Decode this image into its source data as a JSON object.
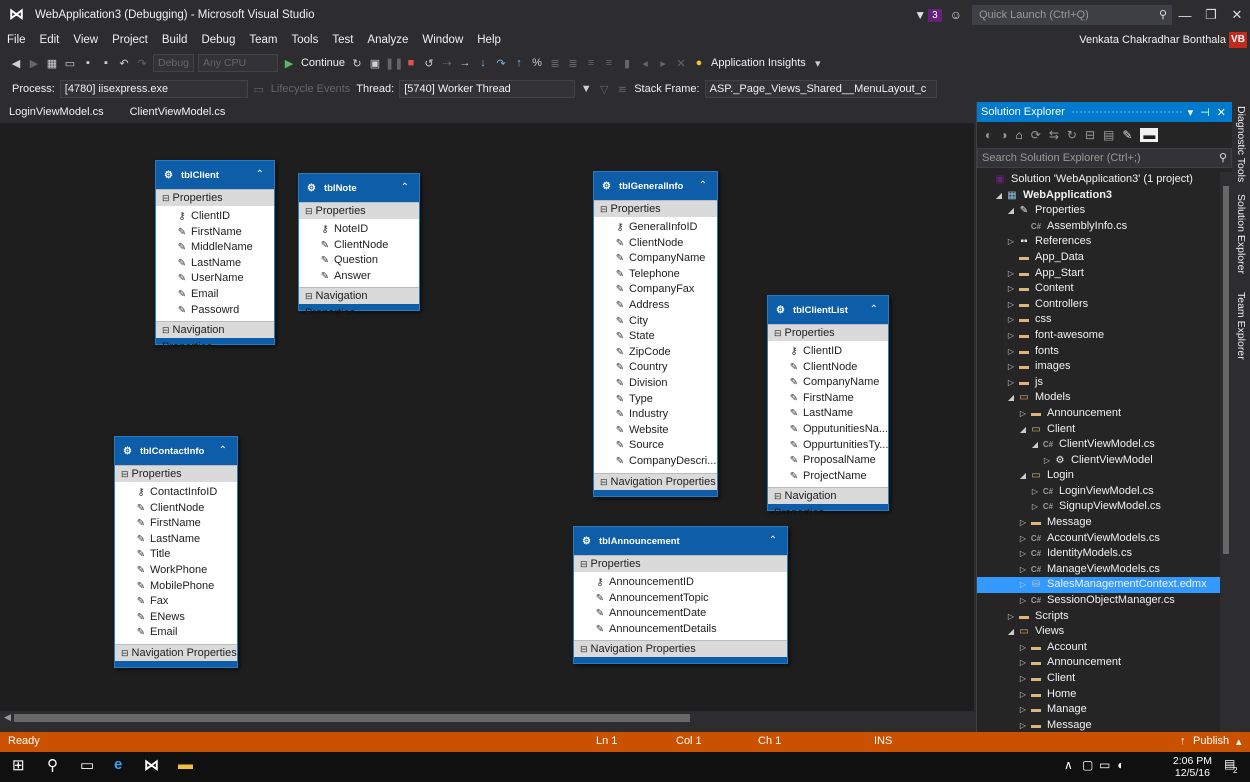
{
  "window": {
    "title": "WebApplication3 (Debugging) - Microsoft Visual Studio",
    "notification_count": "3",
    "quick_launch_placeholder": "Quick Launch (Ctrl+Q)"
  },
  "menu": {
    "items": [
      "File",
      "Edit",
      "View",
      "Project",
      "Build",
      "Debug",
      "Team",
      "Tools",
      "Test",
      "Analyze",
      "Window",
      "Help"
    ],
    "user_name": "Venkata Chakradhar Bonthala",
    "user_initials": "VB"
  },
  "toolbar1": {
    "config": "Debug",
    "platform": "Any CPU",
    "continue_label": "Continue",
    "app_insights": "Application Insights"
  },
  "toolbar2": {
    "process_label": "Process:",
    "process_value": "[4780] iisexpress.exe",
    "lifecycle_label": "Lifecycle Events",
    "thread_label": "Thread:",
    "thread_value": "[5740] Worker Thread",
    "stack_label": "Stack Frame:",
    "stack_value": "ASP._Page_Views_Shared__MenuLayout_c"
  },
  "doc_tabs": [
    "LoginViewModel.cs",
    "ClientViewModel.cs"
  ],
  "designer": {
    "properties_label": "Properties",
    "nav_label": "Navigation Properties",
    "entities": [
      {
        "name": "tblClient",
        "key": "ClientID",
        "props": [
          "FirstName",
          "MiddleName",
          "LastName",
          "UserName",
          "Email",
          "Passowrd"
        ]
      },
      {
        "name": "tblNote",
        "key": "NoteID",
        "props": [
          "ClientNode",
          "Question",
          "Answer"
        ]
      },
      {
        "name": "tblGeneralInfo",
        "key": "GeneralInfoID",
        "props": [
          "ClientNode",
          "CompanyName",
          "Telephone",
          "CompanyFax",
          "Address",
          "City",
          "State",
          "ZipCode",
          "Country",
          "Division",
          "Type",
          "Industry",
          "Website",
          "Source",
          "CompanyDescri..."
        ]
      },
      {
        "name": "tblClientList",
        "key": "ClientID",
        "props": [
          "ClientNode",
          "CompanyName",
          "FirstName",
          "LastName",
          "OpputunitiesNa...",
          "OppurtunitiesTy...",
          "ProposalName",
          "ProjectName"
        ]
      },
      {
        "name": "tblContactInfo",
        "key": "ContactInfoID",
        "props": [
          "ClientNode",
          "FirstName",
          "LastName",
          "Title",
          "WorkPhone",
          "MobilePhone",
          "Fax",
          "ENews",
          "Email"
        ]
      },
      {
        "name": "tblAnnouncement",
        "key": "AnnouncementID",
        "props": [
          "AnnouncementTopic",
          "AnnouncementDate",
          "AnnouncementDetails"
        ]
      }
    ]
  },
  "solution_explorer": {
    "title": "Solution Explorer",
    "search_placeholder": "Search Solution Explorer (Ctrl+;)",
    "nodes": [
      {
        "label": "Solution 'WebApplication3' (1 project)",
        "indent": 0,
        "arrow": "",
        "icon": "sol"
      },
      {
        "label": "WebApplication3",
        "indent": 1,
        "arrow": "open",
        "icon": "proj",
        "bold": true
      },
      {
        "label": "Properties",
        "indent": 2,
        "arrow": "open",
        "icon": "wrench"
      },
      {
        "label": "AssemblyInfo.cs",
        "indent": 3,
        "arrow": "",
        "icon": "cs"
      },
      {
        "label": "References",
        "indent": 2,
        "arrow": "closed",
        "icon": "ref"
      },
      {
        "label": "App_Data",
        "indent": 2,
        "arrow": "",
        "icon": "folder"
      },
      {
        "label": "App_Start",
        "indent": 2,
        "arrow": "closed",
        "icon": "folder"
      },
      {
        "label": "Content",
        "indent": 2,
        "arrow": "closed",
        "icon": "folder"
      },
      {
        "label": "Controllers",
        "indent": 2,
        "arrow": "closed",
        "icon": "folder"
      },
      {
        "label": "css",
        "indent": 2,
        "arrow": "closed",
        "icon": "folder"
      },
      {
        "label": "font-awesome",
        "indent": 2,
        "arrow": "closed",
        "icon": "folder"
      },
      {
        "label": "fonts",
        "indent": 2,
        "arrow": "closed",
        "icon": "folder"
      },
      {
        "label": "images",
        "indent": 2,
        "arrow": "closed",
        "icon": "folder"
      },
      {
        "label": "js",
        "indent": 2,
        "arrow": "closed",
        "icon": "folder"
      },
      {
        "label": "Models",
        "indent": 2,
        "arrow": "open",
        "icon": "folder-open"
      },
      {
        "label": "Announcement",
        "indent": 3,
        "arrow": "closed",
        "icon": "folder"
      },
      {
        "label": "Client",
        "indent": 3,
        "arrow": "open",
        "icon": "folder-open"
      },
      {
        "label": "ClientViewModel.cs",
        "indent": 4,
        "arrow": "open",
        "icon": "cs"
      },
      {
        "label": "ClientViewModel",
        "indent": 5,
        "arrow": "closed",
        "icon": "class"
      },
      {
        "label": "Login",
        "indent": 3,
        "arrow": "open",
        "icon": "folder-open"
      },
      {
        "label": "LoginViewModel.cs",
        "indent": 4,
        "arrow": "closed",
        "icon": "cs"
      },
      {
        "label": "SignupViewModel.cs",
        "indent": 4,
        "arrow": "closed",
        "icon": "cs"
      },
      {
        "label": "Message",
        "indent": 3,
        "arrow": "closed",
        "icon": "folder"
      },
      {
        "label": "AccountViewModels.cs",
        "indent": 3,
        "arrow": "closed",
        "icon": "cs"
      },
      {
        "label": "IdentityModels.cs",
        "indent": 3,
        "arrow": "closed",
        "icon": "cs"
      },
      {
        "label": "ManageViewModels.cs",
        "indent": 3,
        "arrow": "closed",
        "icon": "cs"
      },
      {
        "label": "SalesManagementContext.edmx",
        "indent": 3,
        "arrow": "closed",
        "icon": "edmx",
        "selected": true
      },
      {
        "label": "SessionObjectManager.cs",
        "indent": 3,
        "arrow": "closed",
        "icon": "cs"
      },
      {
        "label": "Scripts",
        "indent": 2,
        "arrow": "closed",
        "icon": "folder"
      },
      {
        "label": "Views",
        "indent": 2,
        "arrow": "open",
        "icon": "folder-open"
      },
      {
        "label": "Account",
        "indent": 3,
        "arrow": "closed",
        "icon": "folder"
      },
      {
        "label": "Announcement",
        "indent": 3,
        "arrow": "closed",
        "icon": "folder"
      },
      {
        "label": "Client",
        "indent": 3,
        "arrow": "closed",
        "icon": "folder"
      },
      {
        "label": "Home",
        "indent": 3,
        "arrow": "closed",
        "icon": "folder"
      },
      {
        "label": "Manage",
        "indent": 3,
        "arrow": "closed",
        "icon": "folder"
      },
      {
        "label": "Message",
        "indent": 3,
        "arrow": "closed",
        "icon": "folder"
      }
    ]
  },
  "side_tabs": [
    "Diagnostic Tools",
    "Solution Explorer",
    "Team Explorer"
  ],
  "status": {
    "ready": "Ready",
    "line": "Ln 1",
    "col": "Col 1",
    "ch": "Ch 1",
    "ins": "INS",
    "publish": "Publish"
  },
  "taskbar": {
    "time": "2:06 PM",
    "date": "12/5/16",
    "notification_count": "2"
  },
  "colors": {
    "accent": "#007acc",
    "entity": "#0e5da8",
    "status": "#ca5100",
    "selection": "#3399ff"
  }
}
